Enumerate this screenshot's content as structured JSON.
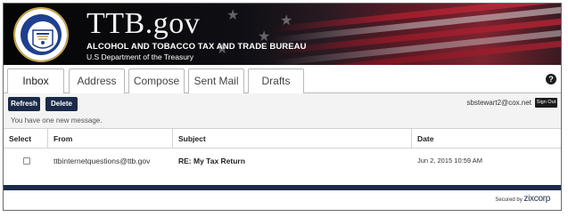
{
  "brand": {
    "title": "TTB.gov",
    "subtitle": "ALCOHOL AND TOBACCO TAX AND TRADE BUREAU",
    "department": "U.S Department of the Treasury",
    "seal_icon": "treasury-seal-icon",
    "accent_color": "#1a2a48"
  },
  "tabs": [
    {
      "label": "Inbox",
      "active": true
    },
    {
      "label": "Address",
      "active": false
    },
    {
      "label": "Compose",
      "active": false
    },
    {
      "label": "Sent Mail",
      "active": false
    },
    {
      "label": "Drafts",
      "active": false
    }
  ],
  "help_label": "?",
  "toolbar": {
    "refresh_label": "Refresh",
    "delete_label": "Delete",
    "notice": "You have one new message.",
    "user_email": "sbstewart2@cox.net",
    "signout_label": "Sign Out"
  },
  "table": {
    "columns": [
      "Select",
      "From",
      "Subject",
      "Date"
    ],
    "rows": [
      {
        "from": "ttbinternetquestions@ttb.gov",
        "subject": "RE: My Tax Return",
        "date": "Jun 2, 2015 10:59 AM",
        "selected": false,
        "unread": true
      }
    ]
  },
  "footer": {
    "secured_by": "Secured by",
    "zix_brand": "zixcorp"
  }
}
